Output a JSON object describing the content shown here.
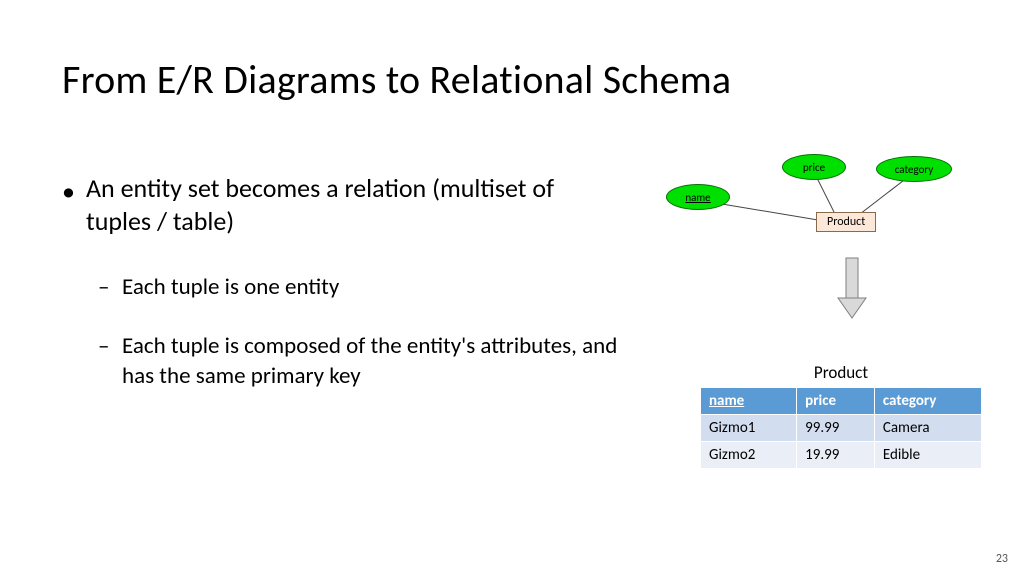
{
  "title": "From E/R Diagrams to Relational Schema",
  "bullet_main": "An entity set becomes a relation (multiset of tuples / table)",
  "sub1": "Each tuple is one entity",
  "sub2": "Each tuple is composed of the entity's attributes, and has the same primary key",
  "er": {
    "attr_name": "name",
    "attr_price": "price",
    "attr_category": "category",
    "entity": "Product"
  },
  "table": {
    "title": "Product",
    "headers": {
      "name": "name",
      "price": "price",
      "category": "category"
    },
    "rows": [
      {
        "name": "Gizmo1",
        "price": "99.99",
        "category": "Camera"
      },
      {
        "name": "Gizmo2",
        "price": "19.99",
        "category": "Edible"
      }
    ]
  },
  "page_number": "23"
}
